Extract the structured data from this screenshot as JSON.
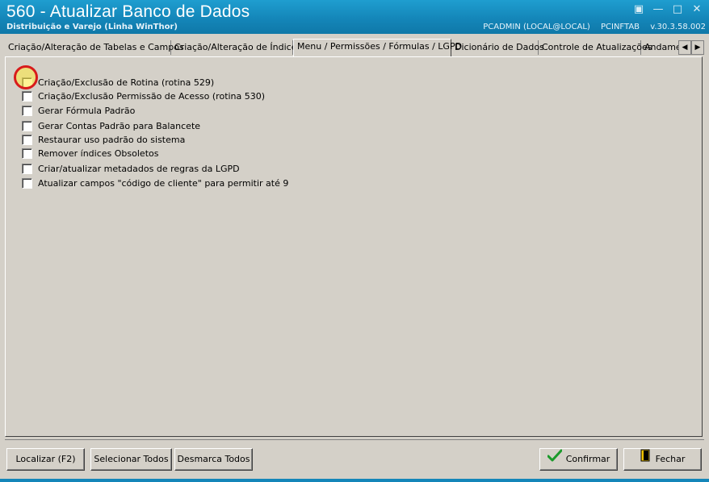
{
  "window": {
    "title": "560 - Atualizar Banco de Dados",
    "subtitle": "Distribuição e Varejo (Linha WinThor)",
    "user": "PCADMIN (LOCAL@LOCAL)",
    "table": "PCINFTAB",
    "version": "v.30.3.58.002"
  },
  "tabs": [
    {
      "label": "Criação/Alteração de Tabelas e Campos",
      "active": false
    },
    {
      "label": "Criação/Alteração de Índices",
      "active": false
    },
    {
      "label": "Menu / Permissões / Fórmulas / LGPD",
      "active": true
    },
    {
      "label": "Dicionário de Dados",
      "active": false
    },
    {
      "label": "Controle de Atualizações",
      "active": false
    },
    {
      "label": "Andame",
      "active": false
    }
  ],
  "options": [
    {
      "label": "Criação/Exclusão de Rotina (rotina 529)",
      "checked": false
    },
    {
      "label": "Criação/Exclusão Permissão de Acesso (rotina 530)",
      "checked": false
    },
    {
      "label": "Gerar Fórmula Padrão",
      "checked": false
    },
    {
      "label": "Gerar Contas Padrão para Balancete",
      "checked": false
    },
    {
      "label": "Restaurar uso padrão do sistema",
      "checked": false
    },
    {
      "label": "Remover índices Obsoletos",
      "checked": false
    },
    {
      "label": "Criar/atualizar metadados de regras da LGPD",
      "checked": false
    },
    {
      "label": "Atualizar campos \"código de cliente\" para permitir até 9",
      "checked": false
    }
  ],
  "buttons": {
    "localizar": "Localizar (F2)",
    "selecionar_todos": "Selecionar Todos",
    "desmarca_todos": "Desmarca Todos",
    "confirmar": "Confirmar",
    "fechar": "Fechar"
  },
  "colors": {
    "titlebar": "#1486b9",
    "face": "#d4d0c8",
    "highlight_ring": "#d81b1b"
  }
}
